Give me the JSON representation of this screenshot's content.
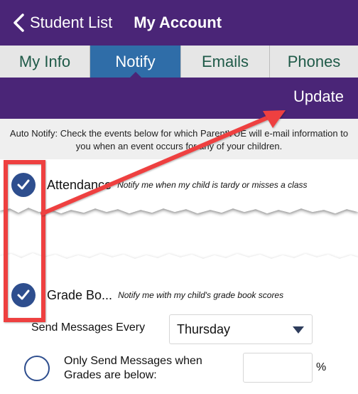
{
  "navbar": {
    "back_label": "Student List",
    "title": "My Account"
  },
  "tabs": [
    {
      "label": "My Info",
      "active": false
    },
    {
      "label": "Notify",
      "active": true
    },
    {
      "label": "Emails",
      "active": false
    },
    {
      "label": "Phones",
      "active": false
    }
  ],
  "action_bar": {
    "update_label": "Update"
  },
  "info_text": "Auto Notify: Check the events below for which ParentVUE will e-mail information to you when an event occurs for any of your children.",
  "events": [
    {
      "label": "Attendance",
      "description": "Notify me when my child is tardy or misses a class",
      "checked": true
    },
    {
      "label": "Grade Bo...",
      "description": "Notify me with my child's grade book scores",
      "checked": true
    }
  ],
  "send_every": {
    "label": "Send Messages Every",
    "value": "Thursday"
  },
  "grades_below": {
    "label": "Only Send Messages when Grades are below:",
    "value": "",
    "unit": "%",
    "selected": false
  },
  "colors": {
    "brand_purple": "#4a2577",
    "tab_active": "#2f6da8",
    "tab_text": "#1f5a48",
    "check_blue": "#2e4e8e",
    "annotation_red": "#ee4040"
  }
}
